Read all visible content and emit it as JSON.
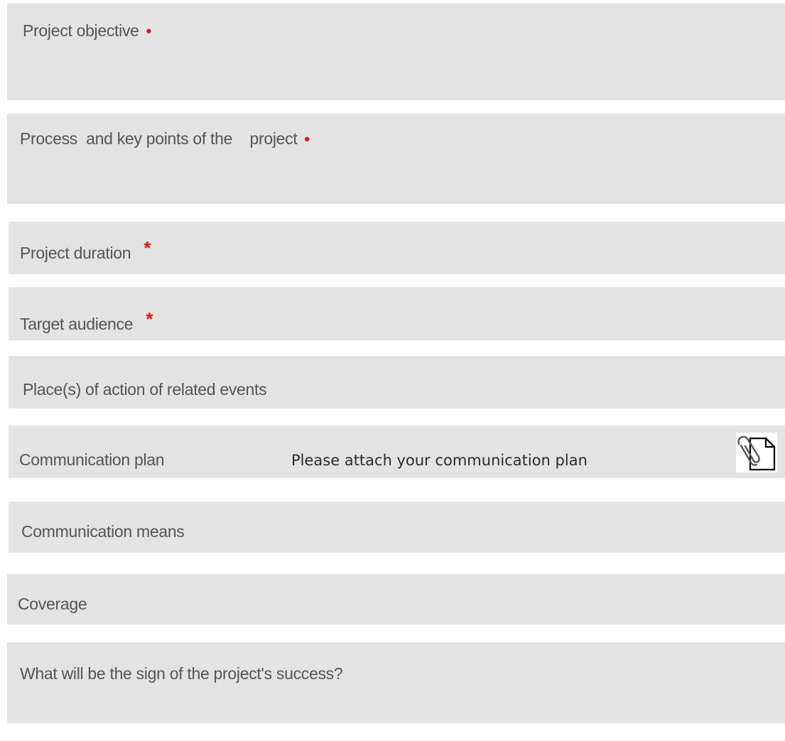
{
  "form": {
    "fields": [
      {
        "label": "Project objective",
        "required": true,
        "required_mark": "•"
      },
      {
        "label": "Process  and key points of the    project",
        "required": true,
        "required_mark": "•"
      },
      {
        "label": "Project duration",
        "required": true,
        "required_mark": "*"
      },
      {
        "label": "Target audience",
        "required": true,
        "required_mark": "*"
      },
      {
        "label": "Place(s) of action of related events",
        "required": false
      },
      {
        "label": "Communication plan",
        "required": false,
        "hint": "Please attach your communication plan",
        "icon": "paperclip-document-icon"
      },
      {
        "label": "Communication means",
        "required": false
      },
      {
        "label": "Coverage",
        "required": false
      },
      {
        "label": "What will be the sign of the project's success?",
        "required": false
      }
    ]
  },
  "colors": {
    "field_bg": "#e3e3e3",
    "label_text": "#555555",
    "required_mark": "#e01515"
  }
}
